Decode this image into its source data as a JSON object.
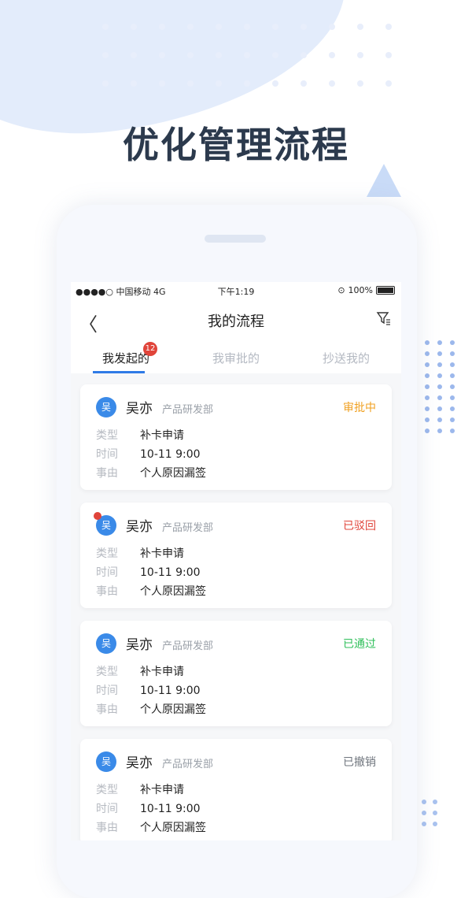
{
  "headline": "优化管理流程",
  "status_bar": {
    "carrier": "●●●●○ 中国移动 4G",
    "time": "下午1:19",
    "battery": "100%"
  },
  "nav": {
    "back_glyph": "〈",
    "title": "我的流程"
  },
  "tabs": [
    {
      "label": "我发起的",
      "badge": "12"
    },
    {
      "label": "我审批的"
    },
    {
      "label": "抄送我的"
    }
  ],
  "field_labels": {
    "type": "类型",
    "time": "时间",
    "reason": "事由"
  },
  "cards": [
    {
      "avatar": "吴",
      "name": "吴亦",
      "dept": "产品研发部",
      "status": "审批中",
      "status_color": "#f0a020",
      "type": "补卡申请",
      "time": "10-11 9:00",
      "reason": "个人原因漏签"
    },
    {
      "avatar": "吴",
      "name": "吴亦",
      "dept": "产品研发部",
      "status": "已驳回",
      "status_color": "#e0443a",
      "type": "补卡申请",
      "time": "10-11 9:00",
      "reason": "个人原因漏签"
    },
    {
      "avatar": "吴",
      "name": "吴亦",
      "dept": "产品研发部",
      "status": "已通过",
      "status_color": "#2fbf5a",
      "type": "补卡申请",
      "time": "10-11 9:00",
      "reason": "个人原因漏签"
    },
    {
      "avatar": "吴",
      "name": "吴亦",
      "dept": "产品研发部",
      "status": "已撤销",
      "status_color": "#6f757d",
      "type": "补卡申请",
      "time": "10-11 9:00",
      "reason": "个人原因漏签"
    }
  ]
}
